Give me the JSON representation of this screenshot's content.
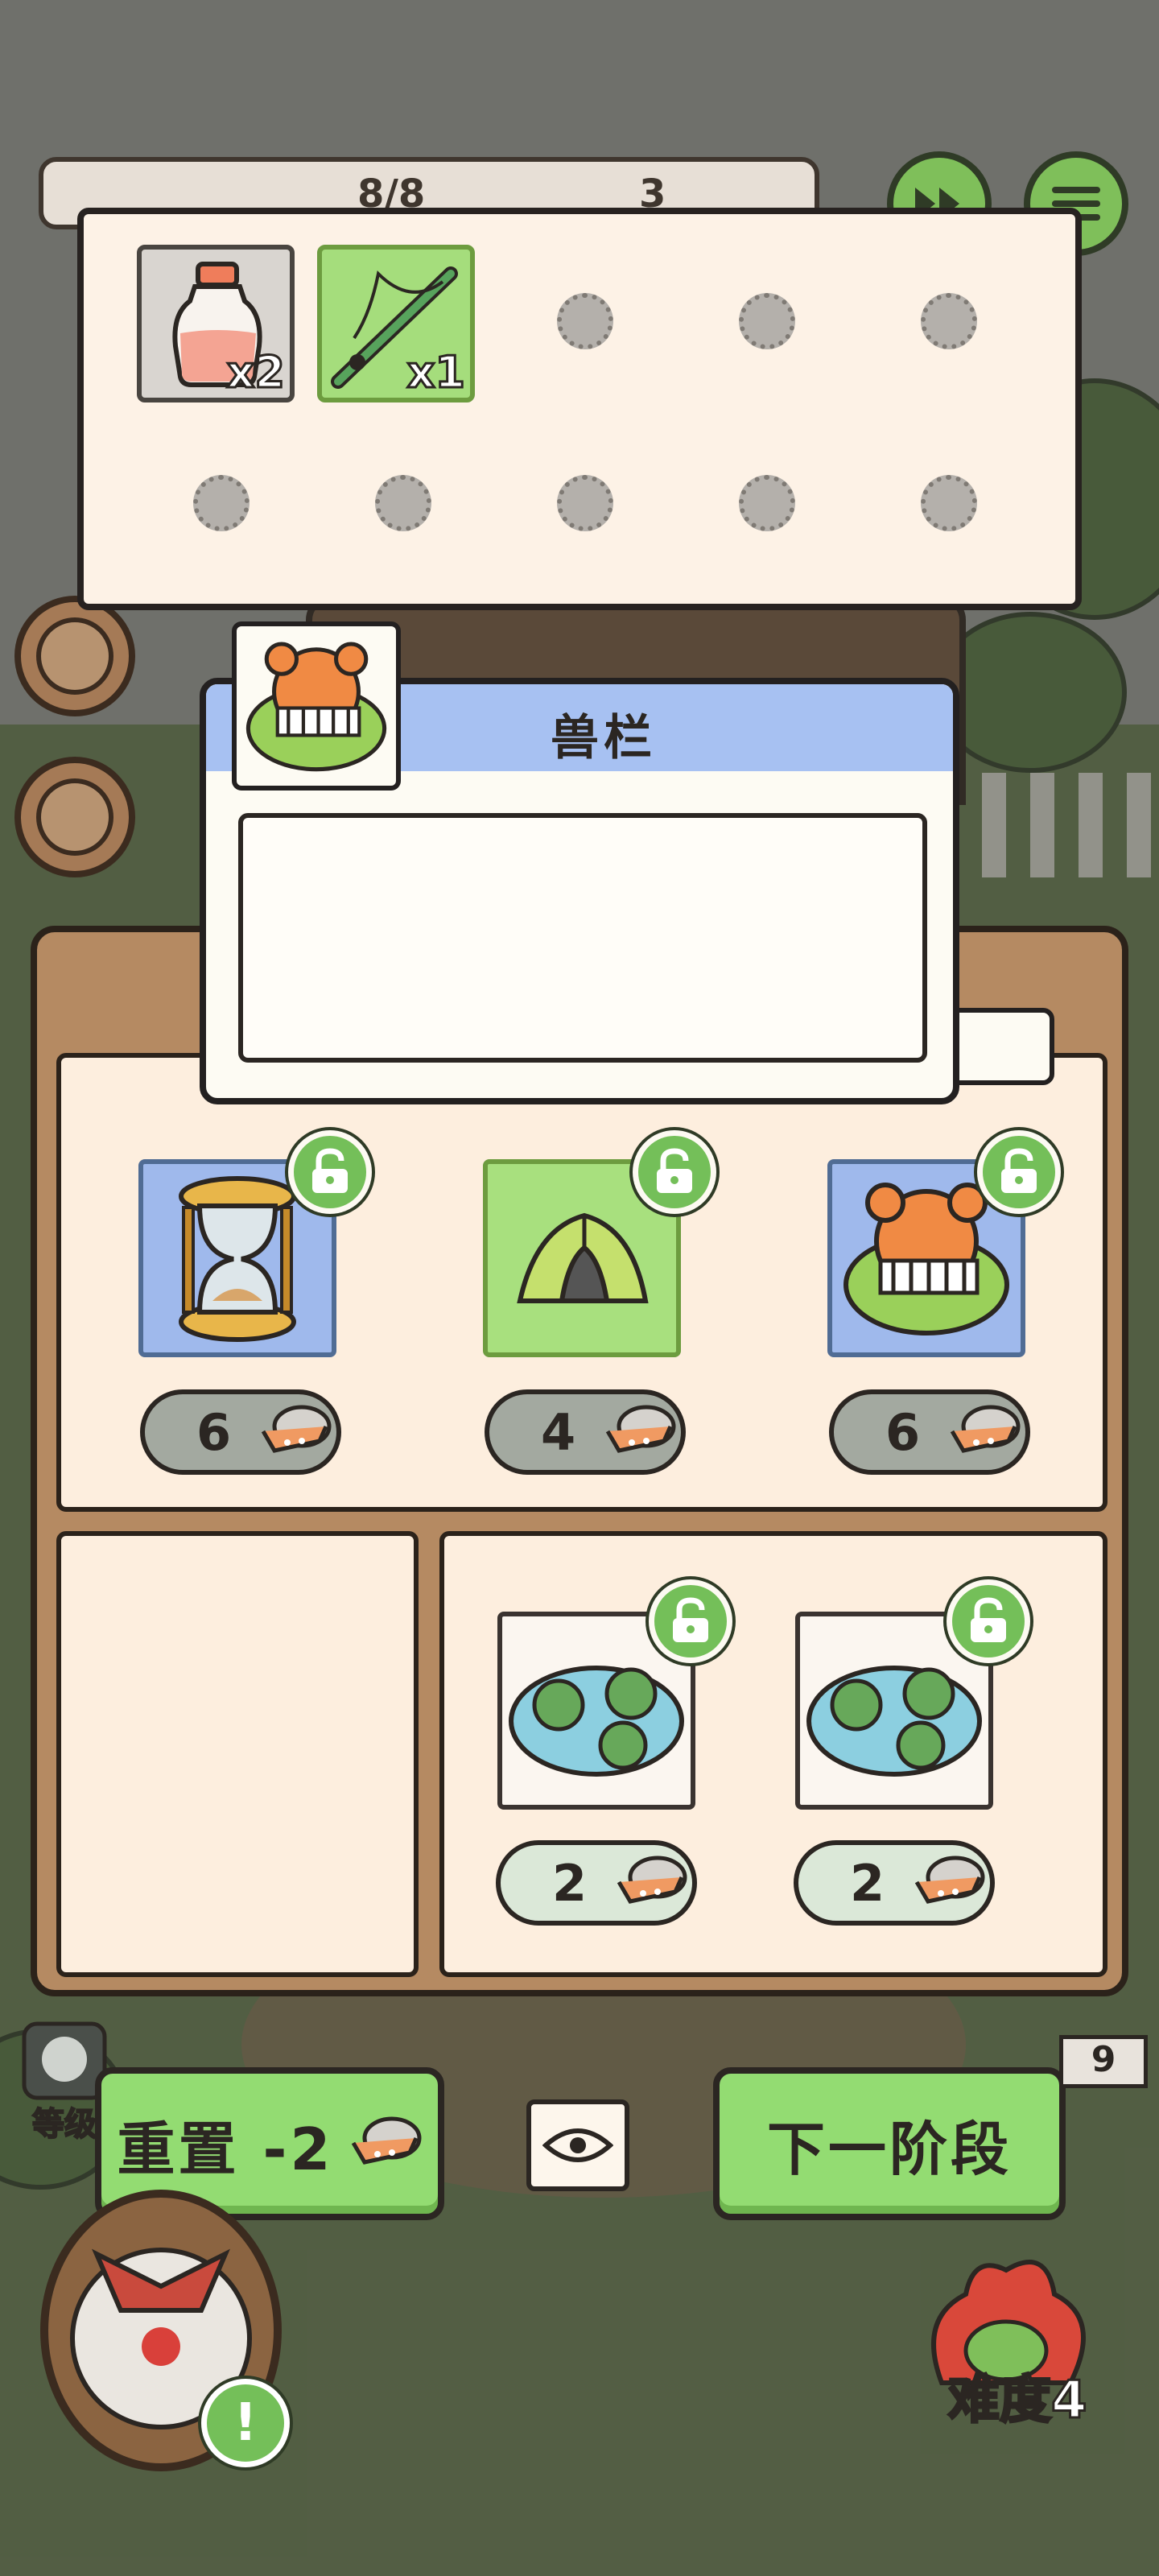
{
  "hud": {
    "energy": "8/8",
    "coins": "3"
  },
  "inventory": {
    "items": [
      {
        "name": "pink-potion-bottle",
        "count": "x2"
      },
      {
        "name": "green-fishing-rod",
        "count": "x1"
      }
    ]
  },
  "tooltip": {
    "title": "兽栏"
  },
  "shop": {
    "tier1": [
      {
        "item": "hourglass",
        "price": "6"
      },
      {
        "item": "tent",
        "price": "4"
      },
      {
        "item": "animal-pen",
        "price": "6"
      }
    ],
    "tier2": [
      {
        "item": "lily-pond",
        "price": "2"
      },
      {
        "item": "lily-pond",
        "price": "2"
      }
    ]
  },
  "buttons": {
    "reset": "重置 -2",
    "next": "下一阶段"
  },
  "status": {
    "level_label": "等级",
    "stage_number": "9",
    "difficulty": "难度4",
    "alert": "!"
  },
  "colors": {
    "accent_green": "#93dc72",
    "panel_brown": "#b58a62",
    "card_blue": "#9fb9ec",
    "tooltip_header": "#a7c1f2"
  }
}
